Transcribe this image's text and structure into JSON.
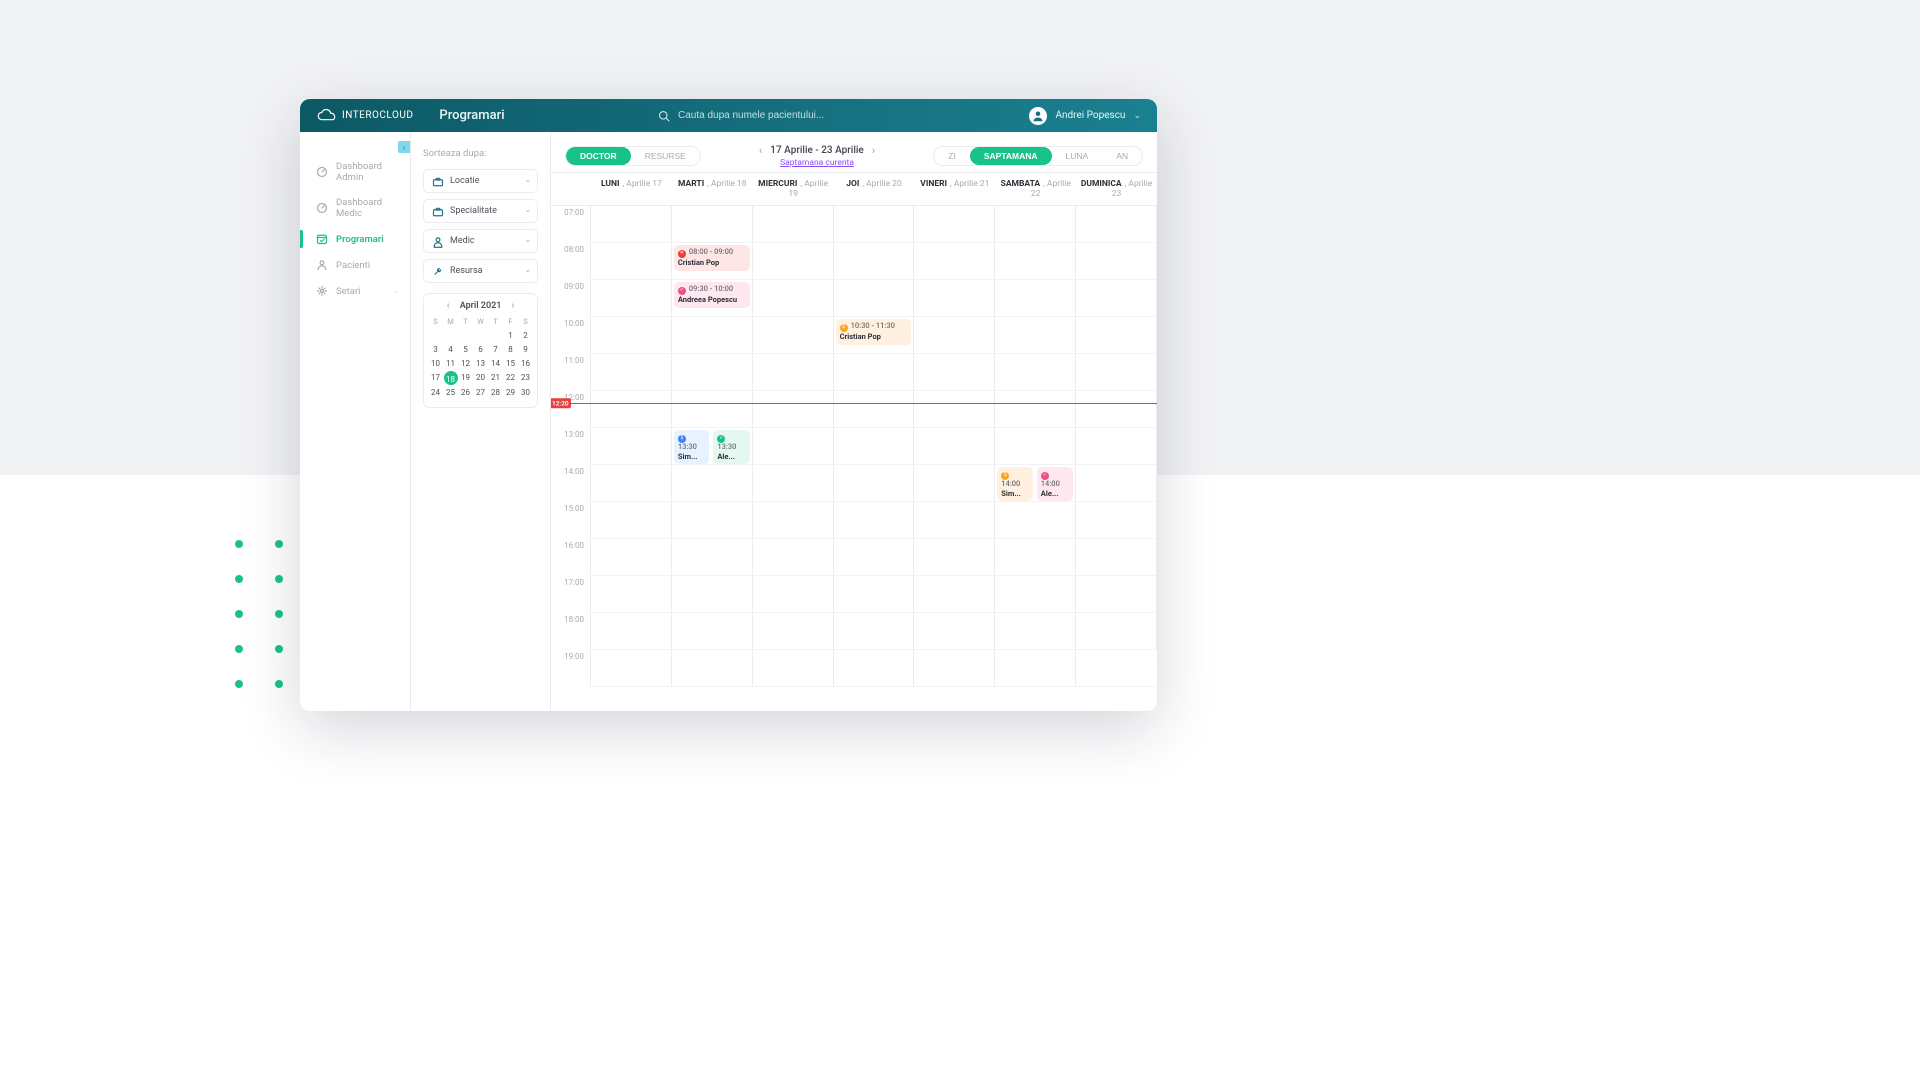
{
  "brand": "INTEROCLOUD",
  "page_title": "Programari",
  "search": {
    "placeholder": "Cauta dupa numele pacientului..."
  },
  "user": {
    "name": "Andrei Popescu"
  },
  "sidebar": {
    "items": [
      {
        "id": "dashboard-admin",
        "label": "Dashboard Admin",
        "icon": "gauge",
        "active": false
      },
      {
        "id": "dashboard-medic",
        "label": "Dashboard Medic",
        "icon": "gauge",
        "active": false
      },
      {
        "id": "programari",
        "label": "Programari",
        "icon": "calendar-check",
        "active": true
      },
      {
        "id": "pacienti",
        "label": "Pacienti",
        "icon": "user",
        "active": false
      },
      {
        "id": "setari",
        "label": "Setari",
        "icon": "gear",
        "active": false,
        "expandable": true
      }
    ]
  },
  "filters": {
    "header": "Sorteaza dupa:",
    "items": [
      {
        "id": "locatie",
        "label": "Locatie",
        "icon": "briefcase"
      },
      {
        "id": "specialitate",
        "label": "Specialitate",
        "icon": "briefcase"
      },
      {
        "id": "medic",
        "label": "Medic",
        "icon": "person"
      },
      {
        "id": "resursa",
        "label": "Resursa",
        "icon": "wrench"
      }
    ]
  },
  "mini_calendar": {
    "title": "April 2021",
    "dow": [
      "S",
      "M",
      "T",
      "W",
      "T",
      "F",
      "S"
    ],
    "weeks": [
      [
        "",
        "",
        "",
        "",
        "",
        "1",
        "2"
      ],
      [
        "3",
        "4",
        "5",
        "6",
        "7",
        "8",
        "9"
      ],
      [
        "10",
        "11",
        "12",
        "13",
        "14",
        "15",
        "16"
      ],
      [
        "17",
        "18",
        "19",
        "20",
        "21",
        "22",
        "23"
      ],
      [
        "24",
        "25",
        "26",
        "27",
        "28",
        "29",
        "30"
      ]
    ],
    "today": "18"
  },
  "toolbar": {
    "mode": {
      "options": [
        "DOCTOR",
        "RESURSE"
      ],
      "selected": "DOCTOR"
    },
    "range_text": "17 Aprilie - 23 Aprilie",
    "current_week_label": "Saptamana curenta",
    "view": {
      "options": [
        "ZI",
        "SAPTAMANA",
        "LUNA",
        "AN"
      ],
      "selected": "SAPTAMANA"
    }
  },
  "week": {
    "days": [
      {
        "dow": "LUNI",
        "date": "Aprilie 17"
      },
      {
        "dow": "MARTI",
        "date": "Aprilie 18"
      },
      {
        "dow": "MIERCURI",
        "date": "Aprilie 19"
      },
      {
        "dow": "JOI",
        "date": "Aprilie 20"
      },
      {
        "dow": "VINERI",
        "date": "Aprilie 21"
      },
      {
        "dow": "SAMBATA",
        "date": "Aprilie 22"
      },
      {
        "dow": "DUMINICA",
        "date": "Aprilie 23"
      }
    ],
    "hours": [
      "07:00",
      "08:00",
      "09:00",
      "10:00",
      "11:00",
      "12:00",
      "13:00",
      "14:00",
      "15:00",
      "16:00",
      "17:00",
      "18:00",
      "19:00"
    ],
    "now": {
      "label": "12:20",
      "hour_index": 5,
      "fraction": 0.33
    }
  },
  "appointments": [
    {
      "day": 1,
      "hour": 1,
      "time": "08:00 - 09:00",
      "name": "Cristian Pop",
      "color": "red",
      "dot_glyph": "✕"
    },
    {
      "day": 1,
      "hour": 2,
      "time": "09:30 - 10:00",
      "name": "Andreea Popescu",
      "color": "pink",
      "dot_glyph": "✓"
    },
    {
      "day": 3,
      "hour": 3,
      "time": "10:30 - 11:30",
      "name": "Cristian Pop",
      "color": "peach",
      "dot_glyph": "$"
    },
    {
      "day": 1,
      "hour": 6,
      "time": "13:30",
      "name": "Sim...",
      "color": "blue",
      "dot_glyph": "$",
      "slot": "left"
    },
    {
      "day": 1,
      "hour": 6,
      "time": "13:30",
      "name": "Ale...",
      "color": "mint",
      "dot_glyph": "✓",
      "slot": "right"
    },
    {
      "day": 5,
      "hour": 7,
      "time": "14:00",
      "name": "Sim...",
      "color": "peach",
      "dot_glyph": "$",
      "slot": "left"
    },
    {
      "day": 5,
      "hour": 7,
      "time": "14:00",
      "name": "Ale...",
      "color": "pink",
      "dot_glyph": "✓",
      "slot": "right"
    }
  ],
  "colors": {
    "green": "#1ac28b",
    "purple": "#8a4ef6",
    "red": "#e73f3f",
    "orange": "#f5a623"
  }
}
